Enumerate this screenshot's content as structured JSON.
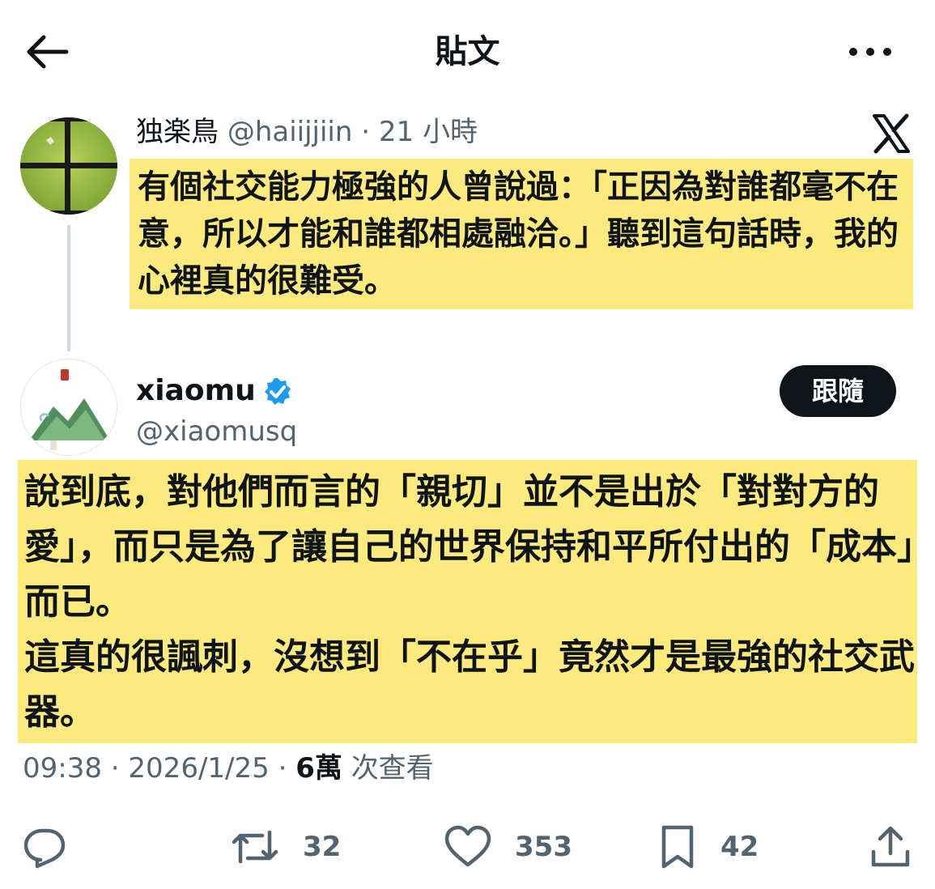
{
  "header": {
    "title": "貼文"
  },
  "quoted_post": {
    "author_name": "独楽鳥",
    "handle": "@haiijjiin",
    "separator": "·",
    "time": "21 小時",
    "text": "有個社交能力極強的人曾說過：「正因為對誰都毫不在意，所以才能和誰都相處融洽。」聽到這句話時，我的心裡真的很難受。"
  },
  "main_post": {
    "author_name": "xiaomu",
    "handle": "@xiaomusq",
    "follow_label": "跟隨",
    "paragraphs": [
      "說到底，對他們而言的「親切」並不是出於「對對方的愛」，而只是為了讓自己的世界保持和平所付出的「成本」而已。",
      "這真的很諷刺，沒想到「不在乎」竟然才是最強的社交武器。"
    ],
    "time": "09:38",
    "date": "2026/1/25",
    "separator": "·",
    "views_count": "6萬",
    "views_label": "次查看"
  },
  "actions": {
    "reply_count": "",
    "retweet_count": "32",
    "like_count": "353",
    "bookmark_count": "42"
  },
  "colors": {
    "highlight": "#fcea7e",
    "text": "#0f1419",
    "secondary": "#536471",
    "verified": "#1d9bf0",
    "button": "#0f1419"
  },
  "icons": [
    "back-arrow-icon",
    "more-icon",
    "x-logo-icon",
    "verified-badge-icon",
    "reply-icon",
    "retweet-icon",
    "like-icon",
    "bookmark-icon",
    "share-icon"
  ]
}
